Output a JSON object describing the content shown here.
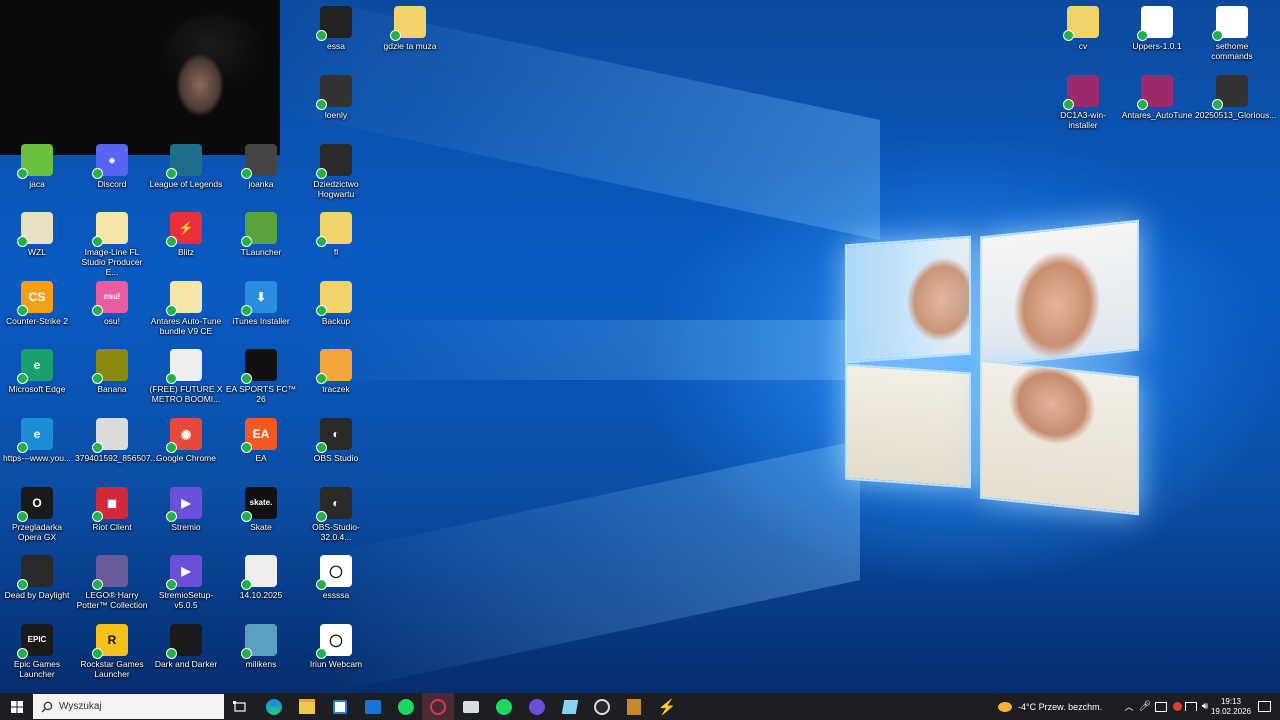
{
  "desktop_icons": [
    {
      "label": "essa",
      "color": "#222"
    },
    {
      "label": "gdzie ta muza",
      "color": "#f2d36a"
    },
    {
      "label": "loenly",
      "color": "#333"
    },
    {
      "label": "jaca",
      "color": "#6cbf3f"
    },
    {
      "label": "Discord",
      "color": "#5865f2"
    },
    {
      "label": "League of Legends",
      "color": "#1f6f8a"
    },
    {
      "label": "joanka",
      "color": "#444"
    },
    {
      "label": "Dziedzictwo Hogwartu",
      "color": "#2a2a2a"
    },
    {
      "label": "WZL",
      "color": "#e8e2c0"
    },
    {
      "label": "Image-Line FL Studio Producer E...",
      "color": "#f4e6a8"
    },
    {
      "label": "Blitz",
      "color": "#e8303c"
    },
    {
      "label": "TLauncher",
      "color": "#59a33a"
    },
    {
      "label": "fl",
      "color": "#f2d36a"
    },
    {
      "label": "Counter-Strike 2",
      "color": "#f29f1c"
    },
    {
      "label": "osu!",
      "color": "#ea5ba0"
    },
    {
      "label": "Antares Auto-Tune bundle V9 CE",
      "color": "#f4e6a8"
    },
    {
      "label": "iTunes Installer",
      "color": "#2a8ee0"
    },
    {
      "label": "Backup",
      "color": "#f2d36a"
    },
    {
      "label": "Microsoft Edge",
      "color": "#1aa06d"
    },
    {
      "label": "Banana",
      "color": "#8a8a10"
    },
    {
      "label": "(FREE) FUTURE X METRO BOOMI...",
      "color": "#eeeeee"
    },
    {
      "label": "EA SPORTS FC™ 26",
      "color": "#111111"
    },
    {
      "label": "traczek",
      "color": "#f2a53a"
    },
    {
      "label": "https---www.you...",
      "color": "#1a8fd6"
    },
    {
      "label": "379401592_856507...",
      "color": "#dcdcdc"
    },
    {
      "label": "Google Chrome",
      "color": "#e64a3b"
    },
    {
      "label": "EA",
      "color": "#f05a22"
    },
    {
      "label": "OBS Studio",
      "color": "#2a2a2a"
    },
    {
      "label": "Przegladarka Opera GX",
      "color": "#1a1a1a"
    },
    {
      "label": "Riot Client",
      "color": "#d1283a"
    },
    {
      "label": "Stremio",
      "color": "#6b4fd8"
    },
    {
      "label": "Skate",
      "color": "#111111"
    },
    {
      "label": "OBS-Studio-32.0.4...",
      "color": "#2a2a2a"
    },
    {
      "label": "Dead by Daylight",
      "color": "#2a2a2a"
    },
    {
      "label": "LEGO® Harry Potter™ Collection",
      "color": "#6a5a9a"
    },
    {
      "label": "StremioSetup-v5.0.5",
      "color": "#6b4fd8"
    },
    {
      "label": "14.10.2025",
      "color": "#eeeeee"
    },
    {
      "label": "essssa",
      "color": "#ffffff"
    },
    {
      "label": "Epic Games Launcher",
      "color": "#1a1a1a"
    },
    {
      "label": "Rockstar Games Launcher",
      "color": "#f6c11a"
    },
    {
      "label": "Dark and Darker",
      "color": "#1a1a1a"
    },
    {
      "label": "milikens",
      "color": "#5aa0c0"
    },
    {
      "label": "Iriun Webcam",
      "color": "#ffffff"
    },
    {
      "label": "cv",
      "color": "#f2d36a"
    },
    {
      "label": "Uppers-1.0.1",
      "color": "#ffffff"
    },
    {
      "label": "sethome commands",
      "color": "#ffffff"
    },
    {
      "label": "DC1A3-win-installer",
      "color": "#9b2a6a"
    },
    {
      "label": "Antares_AutoTune",
      "color": "#9b2a6a"
    },
    {
      "label": "20250513_Glorious...",
      "color": "#333333"
    }
  ],
  "icon_glyphs": {
    "Discord": "●",
    "Blitz": "⚡",
    "osu!": "osu!",
    "Google Chrome": "◉",
    "EA": "EA",
    "Skate": "skate.",
    "Epic Games Launcher": "EPIC",
    "Rockstar Games Launcher": "R",
    "Stremio": "▶",
    "StremioSetup-v5.0.5": "▶",
    "iTunes Installer": "⬇",
    "Riot Client": "◼",
    "OBS Studio": "◐",
    "OBS-Studio-32.0.4...": "◐",
    "Iriun Webcam": "◯",
    "essssa": "◯",
    "Przegladarka Opera GX": "O",
    "Microsoft Edge": "e",
    "https---www.you...": "e",
    "Counter-Strike 2": "CS"
  },
  "taskbar": {
    "search_placeholder": "Wyszukaj",
    "weather": "-4°C  Przew. bezchm.",
    "time": "19:13",
    "date": "19.02.2026",
    "apps": [
      "task-view",
      "edge",
      "file-explorer",
      "store",
      "outlook",
      "spotify",
      "app-red",
      "app-mail",
      "spotify-2",
      "discord",
      "app-blue",
      "obs",
      "app-folder",
      "blitz"
    ]
  },
  "colors": {
    "taskbar": "#1c1e22",
    "accent": "#0a5bc4"
  }
}
